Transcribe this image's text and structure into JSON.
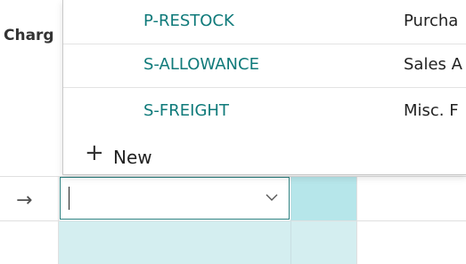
{
  "grid": {
    "column_header": "Charg",
    "input_value": ""
  },
  "dropdown": {
    "items": [
      {
        "code": "P-RESTOCK",
        "description": "Purcha"
      },
      {
        "code": "S-ALLOWANCE",
        "description": "Sales A"
      },
      {
        "code": "S-FREIGHT",
        "description": "Misc. F"
      }
    ],
    "new_label": "New"
  },
  "icons": {
    "row_marker": "arrow-right-icon",
    "dropdown_toggle": "chevron-down-icon",
    "new_item": "plus-icon"
  },
  "colors": {
    "accent": "#0f7a7a",
    "selection": "#b6e6ea",
    "selection_light": "#d4eef0"
  }
}
